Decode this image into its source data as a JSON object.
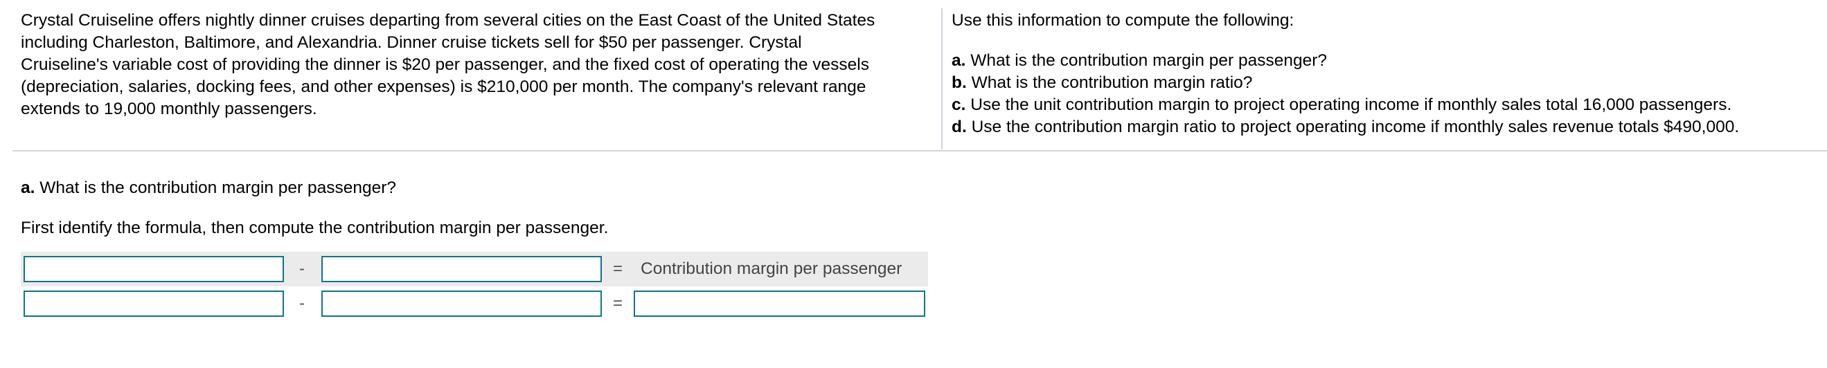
{
  "problem": {
    "intro_lines": [
      "Crystal Cruiseline offers nightly dinner cruises departing from several cities on the East Coast of the United States",
      "including Charleston, Baltimore, and Alexandria. Dinner cruise tickets sell for $50 per passenger. Crystal",
      "Cruiseline's variable cost of providing the dinner is $20 per passenger, and the fixed cost of operating the vessels",
      "(depreciation, salaries, docking fees, and other expenses) is $210,000 per month. The company's relevant range",
      "extends to 19,000 monthly passengers."
    ],
    "tasks_lead": "Use this information to compute the following:",
    "tasks": [
      {
        "letter": "a.",
        "text": " What is the contribution margin per passenger?"
      },
      {
        "letter": "b.",
        "text": " What is the contribution margin ratio?"
      },
      {
        "letter": "c.",
        "text": " Use the unit contribution margin to project operating income if monthly sales total 16,000 passengers."
      },
      {
        "letter": "d.",
        "text": " Use the contribution margin ratio to project operating income if monthly sales revenue totals $490,000."
      }
    ]
  },
  "question": {
    "letter": "a.",
    "title": " What is the contribution margin per passenger?",
    "instruction": "First identify the formula, then compute the contribution margin per passenger."
  },
  "formula": {
    "operator_minus": "-",
    "operator_equals": "=",
    "result_label": "Contribution margin per passenger",
    "formula_row": {
      "first_value": "",
      "second_value": ""
    },
    "answer_row": {
      "first_value": "",
      "second_value": "",
      "result_value": ""
    }
  },
  "colors": {
    "input_border": "#0c7590",
    "header_row_bg": "#ebebeb",
    "divider": "#cfd5df"
  }
}
